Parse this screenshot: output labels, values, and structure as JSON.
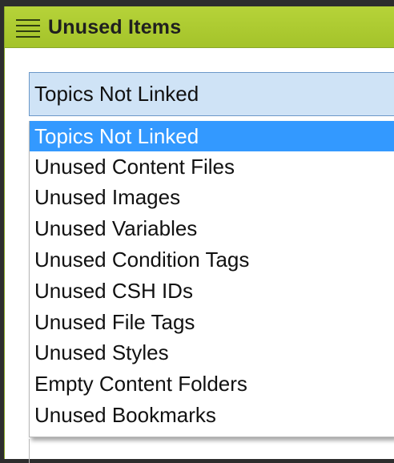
{
  "panel": {
    "title": "Unused Items"
  },
  "combo": {
    "selected": "Topics Not Linked"
  },
  "dropdown": {
    "options": [
      {
        "label": "Topics Not Linked",
        "selected": true
      },
      {
        "label": "Unused Content Files",
        "selected": false
      },
      {
        "label": "Unused Images",
        "selected": false
      },
      {
        "label": "Unused Variables",
        "selected": false
      },
      {
        "label": "Unused Condition Tags",
        "selected": false
      },
      {
        "label": "Unused CSH IDs",
        "selected": false
      },
      {
        "label": "Unused File Tags",
        "selected": false
      },
      {
        "label": "Unused Styles",
        "selected": false
      },
      {
        "label": "Empty Content Folders",
        "selected": false
      },
      {
        "label": "Unused Bookmarks",
        "selected": false
      }
    ]
  },
  "colors": {
    "titlebar": "#a4c32a",
    "selection": "#3399ff",
    "combo_bg": "#cfe3f6"
  },
  "icons": {
    "menu": "hamburger-menu-icon"
  }
}
